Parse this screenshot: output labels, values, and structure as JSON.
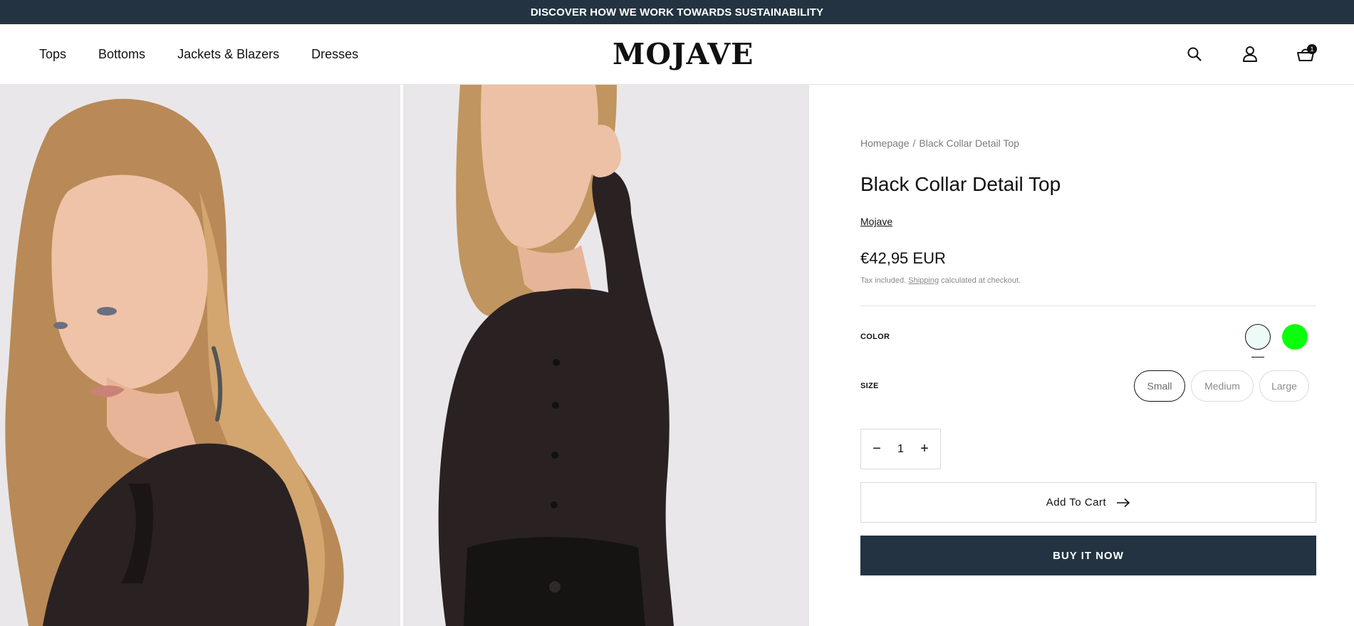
{
  "announcement": {
    "text": "DISCOVER HOW WE WORK TOWARDS SUSTAINABILITY"
  },
  "header": {
    "nav": [
      "Tops",
      "Bottoms",
      "Jackets & Blazers",
      "Dresses"
    ],
    "logo": "MOJAVE",
    "icons": [
      "search-icon",
      "account-icon",
      "cart-icon"
    ],
    "cart_count": "1"
  },
  "gallery": {
    "images": [
      "model-portrait-photo",
      "model-standing-photo"
    ],
    "background_color": "#e9e7ea"
  },
  "product": {
    "breadcrumb": [
      "Homepage",
      "/",
      "Black Collar Detail Top"
    ],
    "title": "Black Collar Detail Top",
    "vendor": "Mojave",
    "price": "€42,95 EUR",
    "tax_prefix": "Tax included.",
    "tax_link": "Shipping",
    "tax_suffix": "calculated at checkout.",
    "color_label": "COLOR",
    "colors": [
      {
        "value": "#eefaf8",
        "selected": true
      },
      {
        "value": "#0bff0b",
        "selected": false
      }
    ],
    "size_label": "SIZE",
    "sizes": [
      "Small",
      "Medium",
      "Large"
    ],
    "selected_size": "Small",
    "quantity": "1",
    "qty_minus": "−",
    "qty_plus": "+",
    "add_to_cart": "Add To Cart",
    "buy_now": "BUY IT NOW"
  },
  "theme": {
    "accent": "#233341",
    "text": "#111111",
    "muted": "#8a8a8a"
  }
}
